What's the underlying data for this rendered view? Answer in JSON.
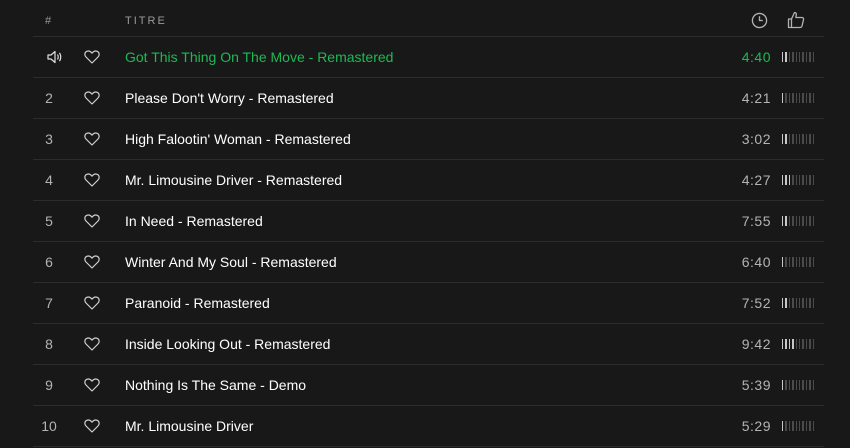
{
  "header": {
    "num_label": "#",
    "title_label": "TITRE",
    "duration_icon": "clock-icon",
    "popularity_icon": "thumbs-up-icon"
  },
  "colors": {
    "background": "#181818",
    "accent_playing": "#1db954",
    "text_primary": "#ffffff",
    "text_secondary": "#b3b3b3"
  },
  "tracks": [
    {
      "num": "",
      "playing": true,
      "title": "Got This Thing On The Move - Remastered",
      "duration": "4:40",
      "popularity_bars": 2
    },
    {
      "num": "2",
      "playing": false,
      "title": "Please Don't Worry - Remastered",
      "duration": "4:21",
      "popularity_bars": 1
    },
    {
      "num": "3",
      "playing": false,
      "title": "High Falootin' Woman - Remastered",
      "duration": "3:02",
      "popularity_bars": 2
    },
    {
      "num": "4",
      "playing": false,
      "title": "Mr. Limousine Driver - Remastered",
      "duration": "4:27",
      "popularity_bars": 3
    },
    {
      "num": "5",
      "playing": false,
      "title": "In Need - Remastered",
      "duration": "7:55",
      "popularity_bars": 2
    },
    {
      "num": "6",
      "playing": false,
      "title": "Winter And My Soul - Remastered",
      "duration": "6:40",
      "popularity_bars": 1
    },
    {
      "num": "7",
      "playing": false,
      "title": "Paranoid - Remastered",
      "duration": "7:52",
      "popularity_bars": 2
    },
    {
      "num": "8",
      "playing": false,
      "title": "Inside Looking Out - Remastered",
      "duration": "9:42",
      "popularity_bars": 4
    },
    {
      "num": "9",
      "playing": false,
      "title": "Nothing Is The Same - Demo",
      "duration": "5:39",
      "popularity_bars": 1
    },
    {
      "num": "10",
      "playing": false,
      "title": "Mr. Limousine Driver",
      "duration": "5:29",
      "popularity_bars": 1
    }
  ]
}
